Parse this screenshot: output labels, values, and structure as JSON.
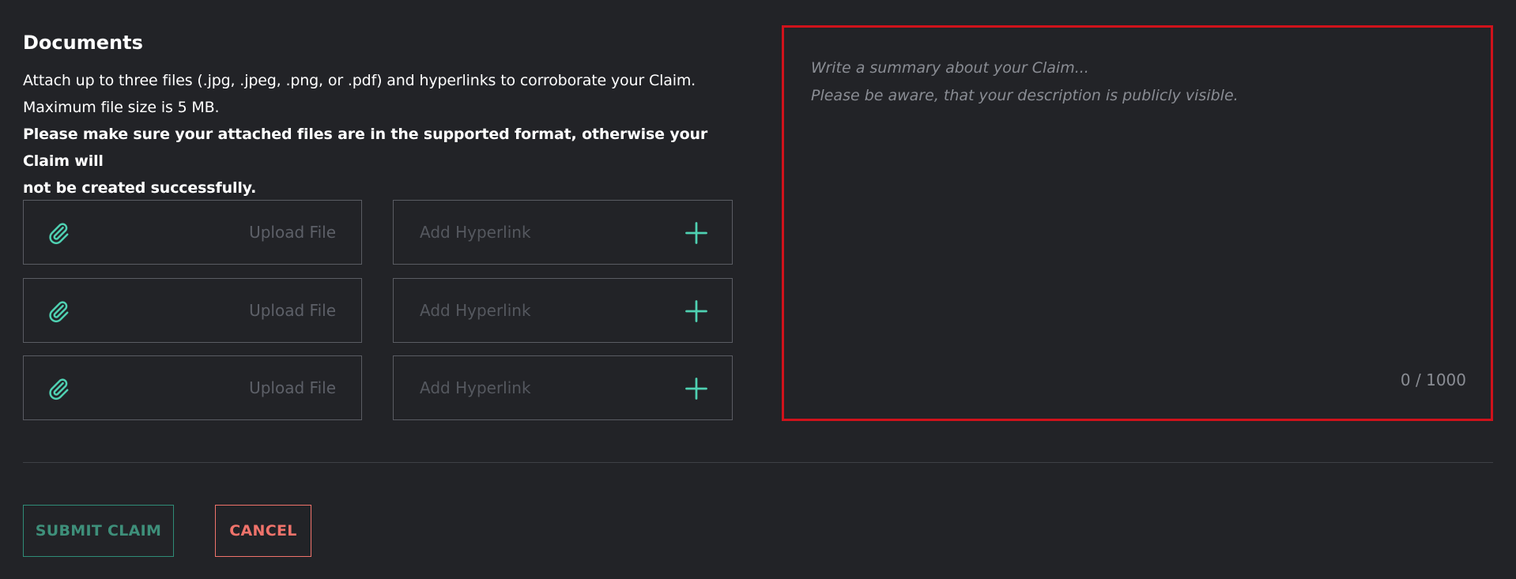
{
  "documents": {
    "heading": "Documents",
    "line1": "Attach up to three files (.jpg, .jpeg, .png, or .pdf) and hyperlinks to corroborate your Claim.",
    "line2": "Maximum file size is 5 MB.",
    "warning_line1": "Please make sure your attached files are in the supported format, otherwise your Claim will",
    "warning_line2": "not be created successfully."
  },
  "attachments": [
    {
      "upload_label": "Upload File",
      "hyperlink_placeholder": "Add Hyperlink",
      "hyperlink_value": ""
    },
    {
      "upload_label": "Upload File",
      "hyperlink_placeholder": "Add Hyperlink",
      "hyperlink_value": ""
    },
    {
      "upload_label": "Upload File",
      "hyperlink_placeholder": "Add Hyperlink",
      "hyperlink_value": ""
    }
  ],
  "summary": {
    "placeholder": "Write a summary about your Claim...\nPlease be aware, that your description is publicly visible.",
    "value": "",
    "counter": "0 / 1000"
  },
  "actions": {
    "submit_label": "SUBMIT CLAIM",
    "cancel_label": "CANCEL"
  },
  "colors": {
    "background": "#222327",
    "accent": "#4fd1b2",
    "submit": "#3e8f7a",
    "cancel": "#f0736b",
    "summary_border": "#d0121b"
  },
  "icons": {
    "upload": "paperclip-icon",
    "add_link": "plus-icon"
  }
}
